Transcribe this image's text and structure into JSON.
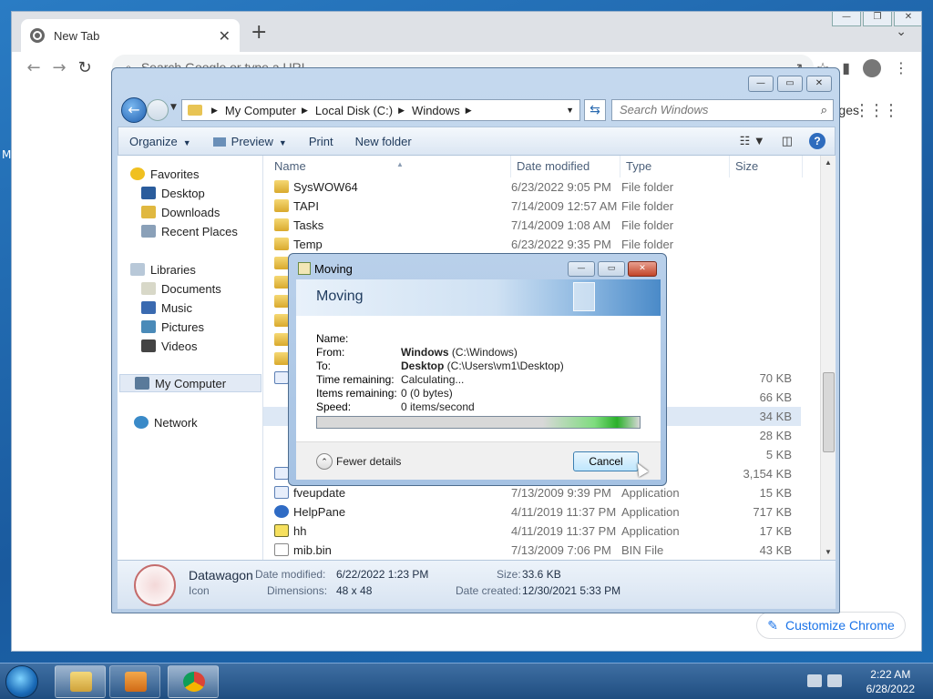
{
  "desktop": {
    "sliver_label": "M"
  },
  "chrome": {
    "tab_title": "New Tab",
    "tab_close": "✕",
    "new_tab": "+",
    "tab_menu": "⌄",
    "back": "←",
    "forward": "→",
    "reload": "↻",
    "omnibox_placeholder": "Search Google or type a URL",
    "ntp_links_label": "ges",
    "apps_glyph": "⋮⋮⋮",
    "customize_label": "Customize Chrome"
  },
  "explorer": {
    "breadcrumb": [
      "My Computer",
      "Local Disk (C:)",
      "Windows"
    ],
    "search_placeholder": "Search Windows",
    "toolbar": {
      "organize": "Organize",
      "preview": "Preview",
      "print": "Print",
      "new_folder": "New folder"
    },
    "nav": {
      "favorites": "Favorites",
      "desktop": "Desktop",
      "downloads": "Downloads",
      "recent": "Recent Places",
      "libraries": "Libraries",
      "documents": "Documents",
      "music": "Music",
      "pictures": "Pictures",
      "videos": "Videos",
      "my_computer": "My Computer",
      "network": "Network"
    },
    "columns": {
      "name": "Name",
      "date": "Date modified",
      "type": "Type",
      "size": "Size"
    },
    "rows": [
      {
        "name": "SysWOW64",
        "date": "6/23/2022 9:05 PM",
        "type": "File folder",
        "size": "",
        "icon": "folder"
      },
      {
        "name": "TAPI",
        "date": "7/14/2009 12:57 AM",
        "type": "File folder",
        "size": "",
        "icon": "folder"
      },
      {
        "name": "Tasks",
        "date": "7/14/2009 1:08 AM",
        "type": "File folder",
        "size": "",
        "icon": "folder"
      },
      {
        "name": "Temp",
        "date": "6/23/2022 9:35 PM",
        "type": "File folder",
        "size": "",
        "icon": "folder"
      },
      {
        "name": "",
        "date": "",
        "type": "er",
        "size": "",
        "icon": "folder"
      },
      {
        "name": "",
        "date": "",
        "type": "er",
        "size": "",
        "icon": "folder"
      },
      {
        "name": "",
        "date": "",
        "type": "er",
        "size": "",
        "icon": "folder"
      },
      {
        "name": "",
        "date": "",
        "type": "er",
        "size": "",
        "icon": "folder"
      },
      {
        "name": "",
        "date": "",
        "type": "er",
        "size": "",
        "icon": "folder"
      },
      {
        "name": "",
        "date": "",
        "type": "er",
        "size": "",
        "icon": "folder"
      },
      {
        "name": "",
        "date": "",
        "type": "ication",
        "size": "70 KB",
        "icon": "exe"
      },
      {
        "name": "",
        "date": "",
        "type": "",
        "size": "66 KB",
        "icon": ""
      },
      {
        "name": "",
        "date": "",
        "type": "",
        "size": "34 KB",
        "icon": "",
        "highlight": true
      },
      {
        "name": "",
        "date": "",
        "type": "cument",
        "size": "28 KB",
        "icon": ""
      },
      {
        "name": "",
        "date": "",
        "type": "cument",
        "size": "5 KB",
        "icon": ""
      },
      {
        "name": "",
        "date": "",
        "type": "ication",
        "size": "3,154 KB",
        "icon": "exe"
      },
      {
        "name": "fveupdate",
        "date": "7/13/2009 9:39 PM",
        "type": "Application",
        "size": "15 KB",
        "icon": "exe"
      },
      {
        "name": "HelpPane",
        "date": "4/11/2019 11:37 PM",
        "type": "Application",
        "size": "717 KB",
        "icon": "help"
      },
      {
        "name": "hh",
        "date": "4/11/2019 11:37 PM",
        "type": "Application",
        "size": "17 KB",
        "icon": "hh"
      },
      {
        "name": "mib.bin",
        "date": "7/13/2009 7:06 PM",
        "type": "BIN File",
        "size": "43 KB",
        "icon": "file"
      }
    ],
    "details": {
      "name": "Datawagon",
      "kind": "Icon",
      "date_modified_label": "Date modified:",
      "date_modified": "6/22/2022 1:23 PM",
      "dimensions_label": "Dimensions:",
      "dimensions": "48 x 48",
      "size_label": "Size:",
      "size": "33.6 KB",
      "date_created_label": "Date created:",
      "date_created": "12/30/2021 5:33 PM"
    }
  },
  "dialog": {
    "title": "Moving",
    "heading": "Moving",
    "name_label": "Name:",
    "name_value": "",
    "from_label": "From:",
    "from_bold": "Windows",
    "from_rest": " (C:\\Windows)",
    "to_label": "To:",
    "to_bold": "Desktop",
    "to_rest": " (C:\\Users\\vm1\\Desktop)",
    "time_label": "Time remaining:",
    "time_value": "Calculating...",
    "items_label": "Items remaining:",
    "items_value": "0 (0 bytes)",
    "speed_label": "Speed:",
    "speed_value": "0 items/second",
    "progress": 1.0,
    "fewer_details": "Fewer details",
    "cancel": "Cancel"
  },
  "taskbar": {
    "time": "2:22 AM",
    "date": "6/28/2022"
  }
}
